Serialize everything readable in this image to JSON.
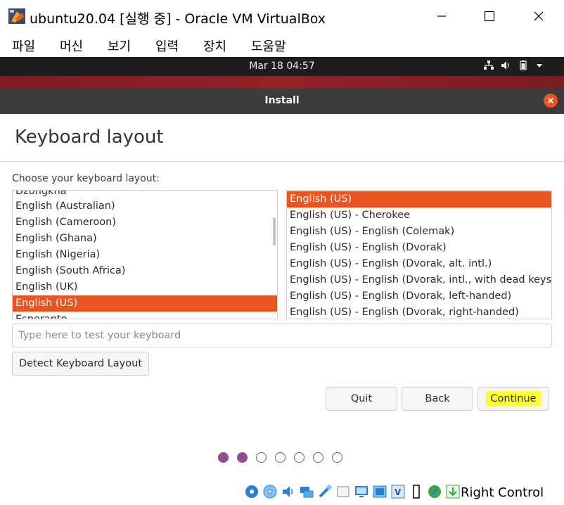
{
  "window": {
    "title": "ubuntu20.04 [실행 중] - Oracle VM VirtualBox",
    "menu": [
      "파일",
      "머신",
      "보기",
      "입력",
      "장치",
      "도움말"
    ]
  },
  "guest_panel": {
    "clock": "Mar 18  04:57",
    "tray_icons": [
      "network-icon",
      "volume-icon",
      "battery-icon",
      "dropdown-arrow-icon"
    ]
  },
  "installer": {
    "header_title": "Install",
    "page_title": "Keyboard layout",
    "prompt": "Choose your keyboard layout:",
    "layouts": [
      {
        "label": "Dzongkha",
        "selected": false
      },
      {
        "label": "English (Australian)",
        "selected": false
      },
      {
        "label": "English (Cameroon)",
        "selected": false
      },
      {
        "label": "English (Ghana)",
        "selected": false
      },
      {
        "label": "English (Nigeria)",
        "selected": false
      },
      {
        "label": "English (South Africa)",
        "selected": false
      },
      {
        "label": "English (UK)",
        "selected": false
      },
      {
        "label": "English (US)",
        "selected": true
      },
      {
        "label": "Esperanto",
        "selected": false
      }
    ],
    "variants": [
      {
        "label": "English (US)",
        "selected": true
      },
      {
        "label": "English (US) - Cherokee",
        "selected": false
      },
      {
        "label": "English (US) - English (Colemak)",
        "selected": false
      },
      {
        "label": "English (US) - English (Dvorak)",
        "selected": false
      },
      {
        "label": "English (US) - English (Dvorak, alt. intl.)",
        "selected": false
      },
      {
        "label": "English (US) - English (Dvorak, intl., with dead keys)",
        "selected": false
      },
      {
        "label": "English (US) - English (Dvorak, left-handed)",
        "selected": false
      },
      {
        "label": "English (US) - English (Dvorak, right-handed)",
        "selected": false
      }
    ],
    "test_placeholder": "Type here to test your keyboard",
    "test_value": "",
    "detect_label": "Detect Keyboard Layout",
    "quit_label": "Quit",
    "back_label": "Back",
    "continue_label": "Continue",
    "progress": {
      "current": 2,
      "total": 7
    }
  },
  "statusbar": {
    "icons": [
      "hard-disk-icon",
      "optical-disk-icon",
      "audio-icon",
      "network-adapter-icon",
      "usb-icon",
      "shared-folder-icon",
      "display-icon",
      "recording-icon",
      "virtualization-icon",
      "cpu-icon",
      "mouse-integration-icon",
      "keyboard-capture-icon"
    ],
    "host_key": "Right Control"
  },
  "colors": {
    "accent": "#e95420",
    "progress_dot": "#924d8b",
    "header_bg": "#3b3b3b",
    "panel_bg": "#1d1d1d",
    "highlight": "#ffff33"
  }
}
